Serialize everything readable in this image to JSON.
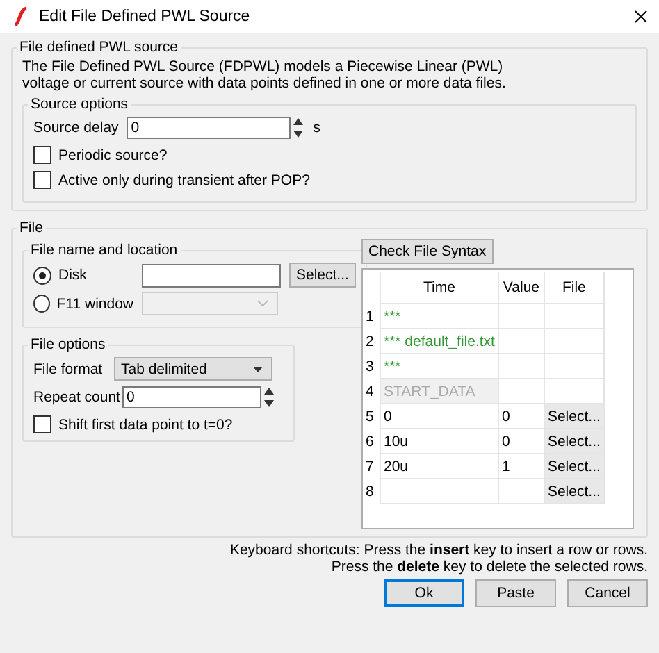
{
  "window": {
    "title": "Edit File Defined PWL Source"
  },
  "source_group": {
    "title": "File defined PWL source",
    "description": "The File Defined PWL Source (FDPWL) models a Piecewise Linear (PWL) voltage or current source with data points defined in one or more data files.",
    "options": {
      "title": "Source options",
      "delay": {
        "label": "Source delay",
        "value": "0",
        "unit": "s"
      },
      "checkboxes": [
        {
          "label": "Periodic source?",
          "checked": false
        },
        {
          "label": "Active only during transient after POP?",
          "checked": false
        }
      ]
    }
  },
  "file_group": {
    "title": "File",
    "location": {
      "title": "File name and location",
      "options": [
        {
          "label": "Disk",
          "selected": true,
          "kind": "field",
          "button": "Select..."
        },
        {
          "label": "F11 window",
          "selected": false,
          "kind": "dropdown",
          "disabled": true
        }
      ]
    },
    "file_options": {
      "title": "File options",
      "format": {
        "label": "File format",
        "value": "Tab delimited"
      },
      "repeat": {
        "label": "Repeat count",
        "value": "0"
      },
      "shift": {
        "label": "Shift first data point to t=0?",
        "checked": false
      }
    },
    "check_button": "Check File Syntax",
    "table": {
      "columns": [
        "Time",
        "Value",
        "File"
      ],
      "rows": [
        {
          "number": "1",
          "kind": "comment",
          "time": "***"
        },
        {
          "number": "2",
          "kind": "comment",
          "time": "*** default_file.txt"
        },
        {
          "number": "3",
          "kind": "comment",
          "time": "***"
        },
        {
          "number": "4",
          "kind": "label",
          "time": "START_DATA"
        },
        {
          "number": "5",
          "kind": "data",
          "time": "0",
          "value": "0",
          "file": "Select..."
        },
        {
          "number": "6",
          "kind": "data",
          "time": "10u",
          "value": "0",
          "file": "Select..."
        },
        {
          "number": "7",
          "kind": "data",
          "time": "20u",
          "value": "1",
          "file": "Select..."
        },
        {
          "number": "8",
          "kind": "data",
          "file": "Select..."
        }
      ]
    }
  },
  "shortcuts": [
    "Keyboard shortcuts: Press the **insert** key to insert a row or rows.",
    "Press the **delete** key to delete the selected rows."
  ],
  "buttons": [
    {
      "label": "Ok",
      "default": true
    },
    {
      "label": "Paste",
      "default": false
    },
    {
      "label": "Cancel",
      "default": false
    }
  ]
}
